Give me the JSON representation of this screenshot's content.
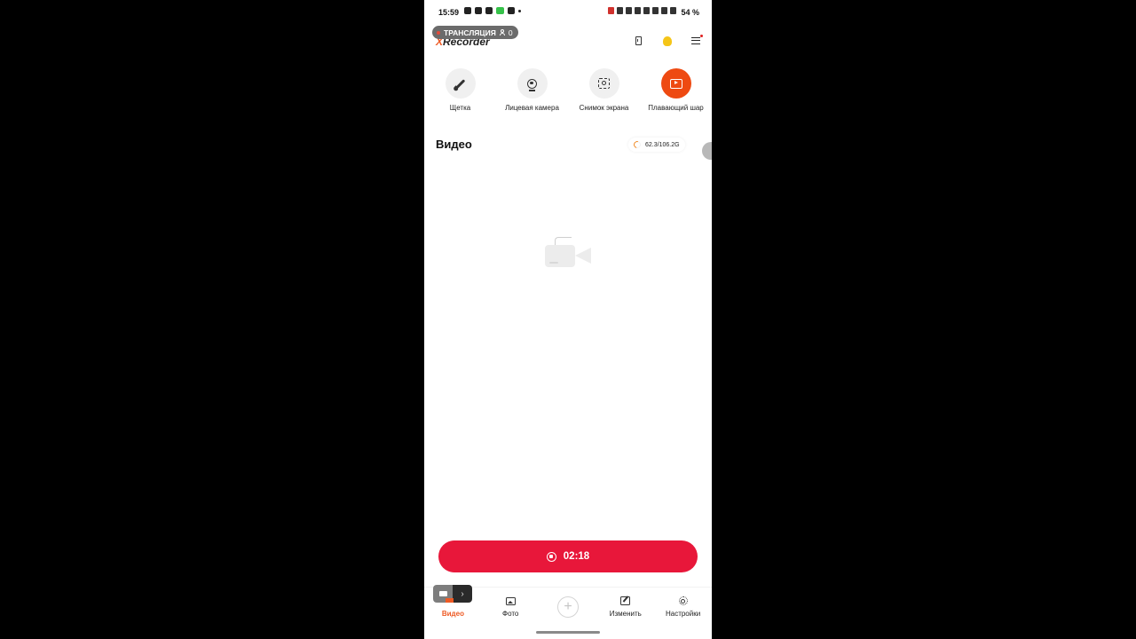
{
  "status_bar": {
    "time": "15:59",
    "battery": "54 %"
  },
  "broadcast": {
    "label": "ТРАНСЛЯЦИЯ",
    "viewers": "0"
  },
  "app": {
    "logo_x": "X",
    "logo_rest": "Recorder"
  },
  "tools": [
    {
      "label": "Щетка",
      "icon": "brush-icon"
    },
    {
      "label": "Лицевая камера",
      "icon": "webcam-icon"
    },
    {
      "label": "Снимок экрана",
      "icon": "screenshot-icon"
    },
    {
      "label": "Плавающий шар",
      "icon": "floating-ball-icon"
    }
  ],
  "videos": {
    "title": "Видео",
    "storage": "62.3/106.2G"
  },
  "record": {
    "time": "02:18"
  },
  "nav": [
    {
      "label": "Видео",
      "active": true
    },
    {
      "label": "Фото"
    },
    {
      "label": ""
    },
    {
      "label": "Изменить"
    },
    {
      "label": "Настройки"
    }
  ],
  "colors": {
    "accent": "#ee5a24",
    "record": "#e8173a",
    "floating_ball": "#ee4a12"
  }
}
